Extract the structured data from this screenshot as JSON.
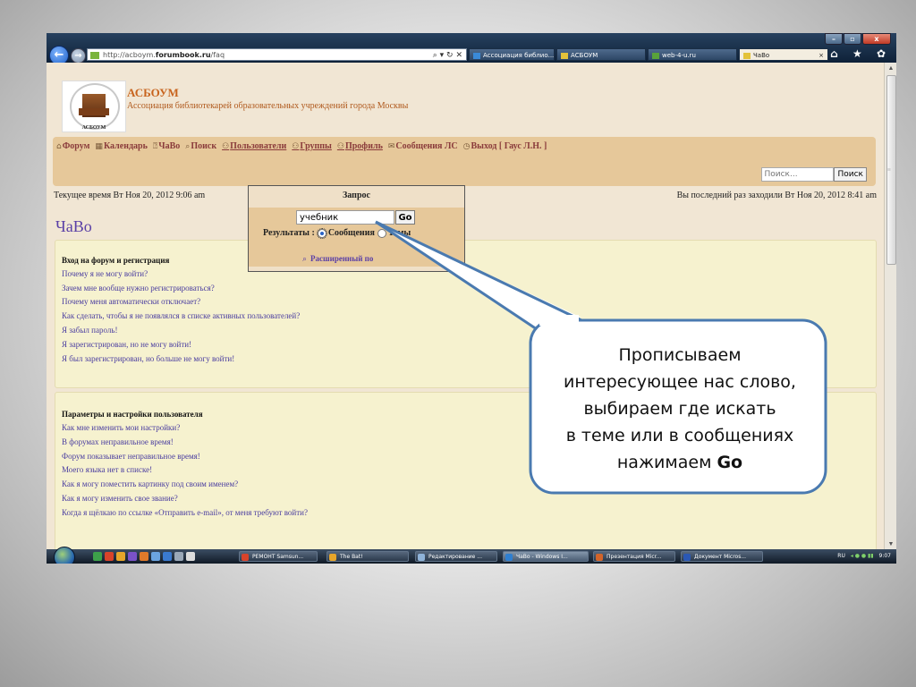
{
  "browser": {
    "url_prefix": "http://acboym.",
    "url_domain": "forumbook.ru",
    "url_suffix": "/faq",
    "addr_icons": "⌕ ▾ ↻ ✕",
    "tabs": [
      {
        "label": "Ассоциация библио...",
        "icon": "ie-icon"
      },
      {
        "label": "АСБОУМ",
        "icon": "forum-icon"
      },
      {
        "label": "web-4-u.ru",
        "icon": "web-icon"
      },
      {
        "label": "ЧаВо",
        "icon": "forum-icon",
        "close": "×"
      }
    ],
    "tools": "⌂ ★ ✿",
    "win_buttons": [
      "–",
      "▫",
      "x"
    ]
  },
  "site": {
    "logo_text": "АСБОУМ",
    "title": "АСБОУМ",
    "subtitle": "Ассоциация библиотекарей образовательных учреждений города Москвы"
  },
  "nav": {
    "items": [
      {
        "icon": "⌂",
        "label": "Форум"
      },
      {
        "icon": "▦",
        "label": "Календарь"
      },
      {
        "icon": "⍰",
        "label": "ЧаВо"
      },
      {
        "icon": "⌕",
        "label": "Поиск"
      },
      {
        "icon": "⚇",
        "label": "Пользователи"
      },
      {
        "icon": "⚇",
        "label": "Группы"
      },
      {
        "icon": "⚇",
        "label": "Профиль"
      },
      {
        "icon": "✉",
        "label": "Сообщения ЛС"
      },
      {
        "icon": "◷",
        "label": "Выход [ Гаус Л.Н. ]"
      }
    ],
    "search_placeholder": "Поиск...",
    "search_button": "Поиск"
  },
  "status": {
    "current_time": "Текущее время Вт Ноя 20, 2012 9:06 am",
    "last_visit": "Вы последний раз заходили Вт Ноя 20, 2012 8:41 am"
  },
  "page_title": "ЧаВо",
  "faq": [
    {
      "heading": "Вход на форум и регистрация",
      "items": [
        "Почему я не могу войти?",
        "Зачем мне вообще нужно регистрироваться?",
        "Почему меня автоматически отключает?",
        "Как сделать, чтобы я не появлялся в списке активных пользователей?",
        "Я забыл пароль!",
        "Я зарегистрирован, но не могу войти!",
        "Я был зарегистрирован, но больше не могу войти!"
      ]
    },
    {
      "heading": "Параметры и настройки пользователя",
      "items": [
        "Как мне изменить мои настройки?",
        "В форумах неправильное время!",
        "Форум показывает неправильное время!",
        "Моего языка нет в списке!",
        "Как я могу поместить картинку под своим именем?",
        "Как я могу изменить свое звание?",
        "Когда я щёлкаю по ссылке «Отправить e-mail», от меня требуют войти?"
      ]
    }
  ],
  "popup": {
    "title": "Запрос",
    "query": "учебник",
    "go": "Go",
    "results_label": "Результаты :",
    "option_posts": "Сообщения",
    "option_topics": "Темы",
    "selected": "posts",
    "advanced": "Расширенный по"
  },
  "callout": {
    "lines": [
      "Прописываем",
      "интересующее нас слово,",
      "выбираем где искать",
      "в теме или в сообщениях"
    ],
    "last_prefix": "нажимаем ",
    "last_bold": "Go"
  },
  "taskbar": {
    "tasks": [
      {
        "label": "РЕМОНТ Samsun...",
        "color": "#d8432a"
      },
      {
        "label": "The Bat!",
        "color": "#e6a52a"
      },
      {
        "label": "Редактирование ...",
        "color": "#8fb3d9"
      },
      {
        "label": "ЧаВо - Windows I...",
        "color": "#2f7fd0"
      },
      {
        "label": "Презентация Micr...",
        "color": "#d2642a"
      },
      {
        "label": "Документ Micros...",
        "color": "#2a58b5"
      }
    ],
    "lang": "RU",
    "clock": "9:07"
  },
  "colors": {
    "page_bg": "#f1e6d4",
    "nav_bg": "#e6c89a",
    "faq_bg": "#f6f2cf",
    "link": "#4a3da0",
    "title_orange": "#c8641e",
    "callout_border": "#4a7ab0"
  }
}
